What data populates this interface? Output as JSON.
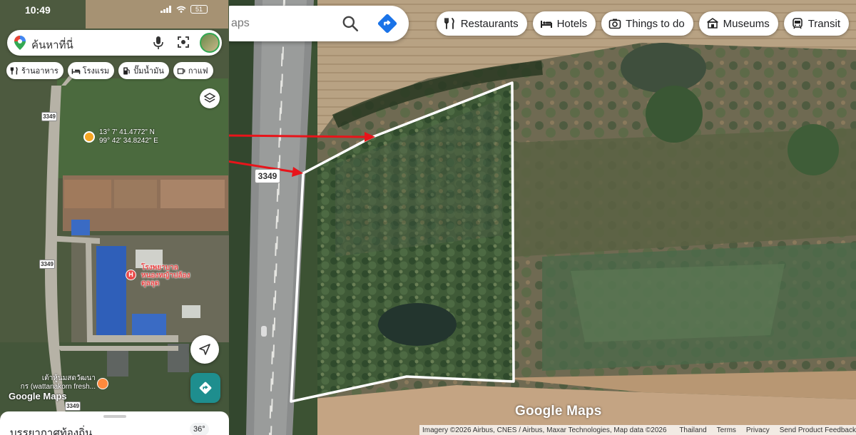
{
  "desktop": {
    "search": {
      "placeholder": "aps"
    },
    "chips": [
      {
        "icon": "restaurant-icon",
        "label": "Restaurants"
      },
      {
        "icon": "hotel-icon",
        "label": "Hotels"
      },
      {
        "icon": "camera-icon",
        "label": "Things to do"
      },
      {
        "icon": "museum-icon",
        "label": "Museums"
      },
      {
        "icon": "transit-icon",
        "label": "Transit"
      }
    ],
    "road_shield": "3349",
    "logo": "Google Maps",
    "attribution": {
      "imagery": "Imagery ©2026 Airbus, CNES / Airbus, Maxar Technologies, Map data ©2026",
      "country": "Thailand",
      "terms": "Terms",
      "privacy": "Privacy",
      "feedback": "Send Product Feedback"
    },
    "colors": {
      "boundary": "#ffffff",
      "arrow": "#e8141a",
      "accent": "#1a73e8"
    }
  },
  "mobile": {
    "status": {
      "time": "10:49",
      "battery": "51"
    },
    "search": {
      "placeholder": "ค้นหาที่นี่"
    },
    "chips": [
      {
        "icon": "restaurant-icon",
        "label": "ร้านอาหาร"
      },
      {
        "icon": "hotel-icon",
        "label": "โรงแรม"
      },
      {
        "icon": "gas-icon",
        "label": "ปั๊มน้ำมัน"
      },
      {
        "icon": "coffee-icon",
        "label": "กาแฟ"
      }
    ],
    "coordinates": {
      "lat": "13° 7' 41.4772\" N",
      "lon": "99° 42' 34.8242\" E"
    },
    "road_shields": [
      "3349",
      "3349",
      "3349"
    ],
    "hospital": {
      "label_line1": "โรงพยาบาล",
      "label_line2": "หนองหญ้าปล้อง",
      "label_line3": "ดุลลุด"
    },
    "shop": {
      "label_line1": "เต้าหู้นมสดวัฒนา",
      "label_line2": "กร (wattanakorn fresh..."
    },
    "logo": "Google Maps",
    "sheet": {
      "title": "บรรยากาศท้องถิ่น",
      "temperature": "36°"
    }
  }
}
